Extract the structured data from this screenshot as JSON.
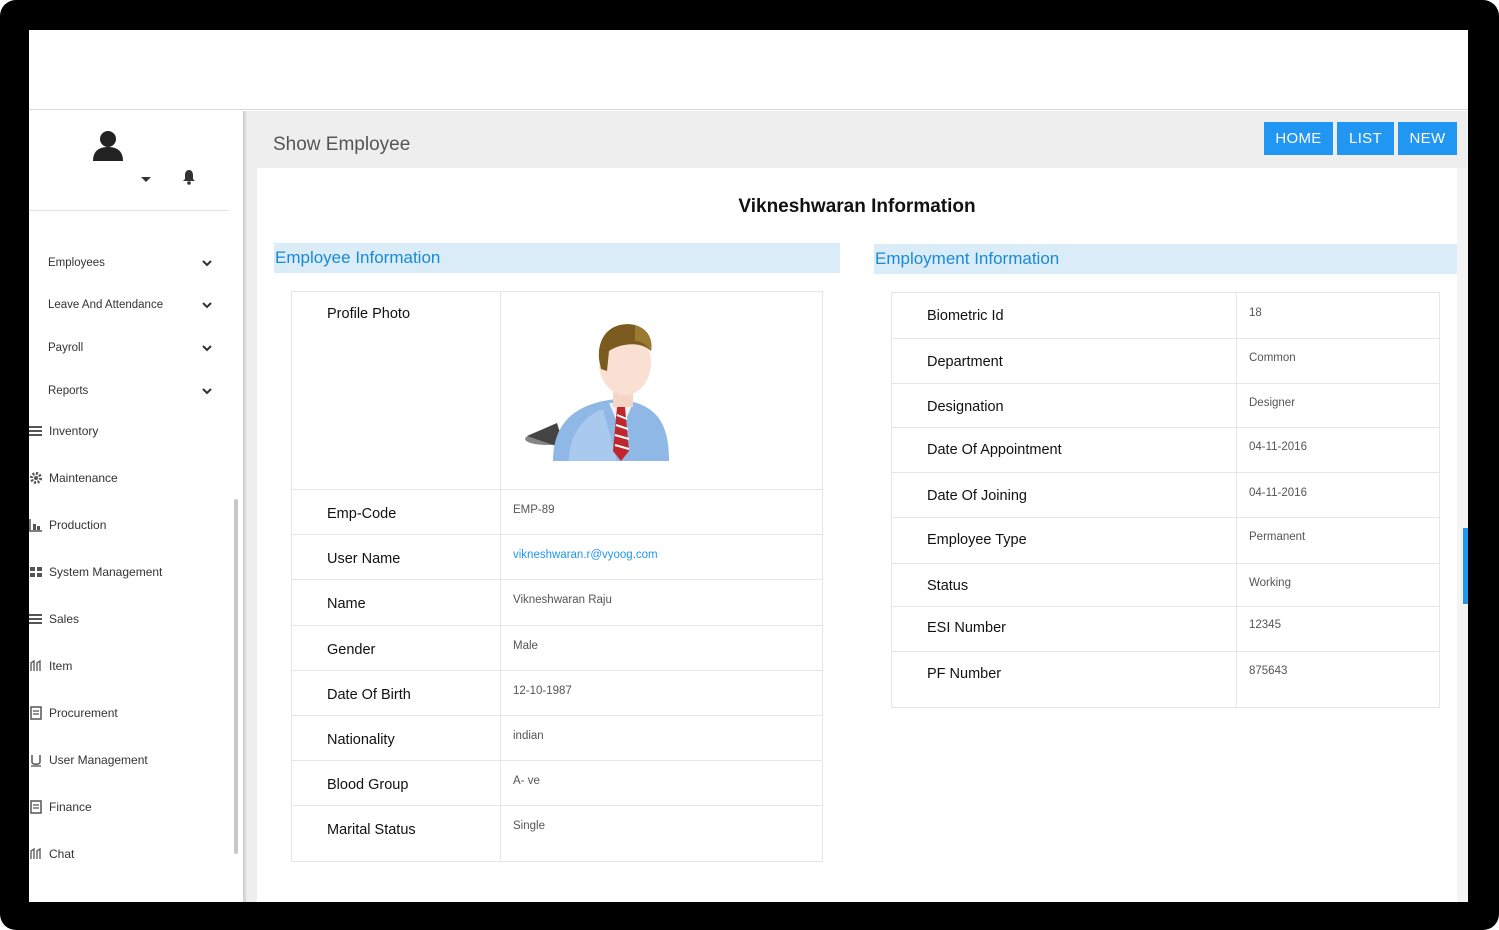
{
  "page": {
    "title": "Show Employee",
    "heading": "Vikneshwaran Information"
  },
  "header_buttons": {
    "home": "HOME",
    "list": "LIST",
    "new": "NEW"
  },
  "sidebar": {
    "user_icon": "user-icon",
    "notification_icon": "bell-icon",
    "items": [
      {
        "label": "Employees",
        "icon": "chevron-down-icon",
        "submenu": true
      },
      {
        "label": "Leave And Attendance",
        "icon": "chevron-down-icon",
        "submenu": true
      },
      {
        "label": "Payroll",
        "icon": "chevron-down-icon",
        "submenu": true
      },
      {
        "label": "Reports",
        "icon": "chevron-down-icon",
        "submenu": true
      },
      {
        "label": "Inventory",
        "icon": "stack-icon"
      },
      {
        "label": "Maintenance",
        "icon": "gear-icon"
      },
      {
        "label": "Production",
        "icon": "chart-icon"
      },
      {
        "label": "System Management",
        "icon": "grid-icon"
      },
      {
        "label": "Sales",
        "icon": "stack-icon"
      },
      {
        "label": "Item",
        "icon": "tag-icon"
      },
      {
        "label": "Procurement",
        "icon": "document-icon"
      },
      {
        "label": "User Management",
        "icon": "user-u-icon"
      },
      {
        "label": "Finance",
        "icon": "document-icon"
      },
      {
        "label": "Chat",
        "icon": "tag-icon"
      }
    ]
  },
  "employee_info": {
    "section_title": "Employee Information",
    "profile_photo_label": "Profile Photo",
    "rows": [
      {
        "label": "Emp-Code",
        "value": "EMP-89"
      },
      {
        "label": "User Name",
        "value": "vikneshwaran.r@vyoog.com"
      },
      {
        "label": "Name",
        "value": "Vikneshwaran Raju"
      },
      {
        "label": "Gender",
        "value": "Male"
      },
      {
        "label": "Date Of Birth",
        "value": "12-10-1987"
      },
      {
        "label": "Nationality",
        "value": "indian"
      },
      {
        "label": "Blood Group",
        "value": "A- ve"
      },
      {
        "label": "Marital Status",
        "value": "Single"
      }
    ]
  },
  "employment_info": {
    "section_title": "Employment Information",
    "rows": [
      {
        "label": "Biometric Id",
        "value": "18"
      },
      {
        "label": "Department",
        "value": "Common"
      },
      {
        "label": "Designation",
        "value": "Designer"
      },
      {
        "label": "Date Of Appointment",
        "value": "04-11-2016"
      },
      {
        "label": "Date Of Joining",
        "value": "04-11-2016"
      },
      {
        "label": "Employee Type",
        "value": "Permanent"
      },
      {
        "label": "Status",
        "value": "Working"
      },
      {
        "label": "ESI Number",
        "value": "12345"
      },
      {
        "label": "PF Number",
        "value": "875643"
      }
    ]
  },
  "colors": {
    "accent": "#2196f3",
    "section_bg": "#d9ecf7",
    "section_text": "#1a8ad6"
  }
}
